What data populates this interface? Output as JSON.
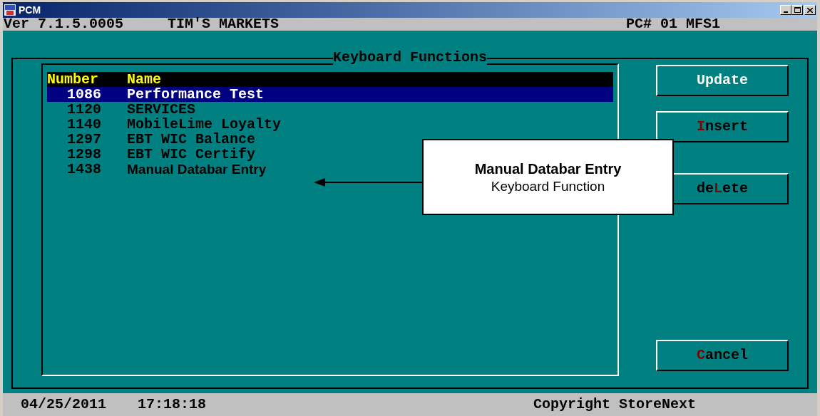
{
  "window": {
    "title": "PCM"
  },
  "header": {
    "version": "Ver 7.1.5.0005",
    "store": "TIM'S MARKETS",
    "terminal": "PC# 01 MFS1"
  },
  "panel": {
    "title": "Keyboard Functions"
  },
  "table": {
    "columns": [
      "Number",
      "Name"
    ],
    "rows": [
      {
        "number": "1086",
        "name": "Performance Test",
        "selected": true,
        "kind": "screen"
      },
      {
        "number": "1120",
        "name": "SERVICES",
        "selected": false,
        "kind": "screen"
      },
      {
        "number": "1140",
        "name": "MobileLime Loyalty",
        "selected": false,
        "kind": "screen"
      },
      {
        "number": "1297",
        "name": "EBT WIC Balance",
        "selected": false,
        "kind": "screen"
      },
      {
        "number": "1298",
        "name": "EBT WIC Certify",
        "selected": false,
        "kind": "screen"
      },
      {
        "number": "1438",
        "name": "Manual Databar Entry",
        "selected": false,
        "kind": "overlay"
      }
    ]
  },
  "buttons": [
    {
      "parts": [
        {
          "text": "Update",
          "hotkey": false
        }
      ],
      "focused": true
    },
    {
      "parts": [
        {
          "text": "I",
          "hotkey": true
        },
        {
          "text": "nsert",
          "hotkey": false
        }
      ],
      "focused": false
    },
    {
      "parts": [
        {
          "text": "de",
          "hotkey": false
        },
        {
          "text": "L",
          "hotkey": true
        },
        {
          "text": "ete",
          "hotkey": false
        }
      ],
      "focused": false
    },
    {
      "parts": [
        {
          "text": "C",
          "hotkey": true
        },
        {
          "text": "ancel",
          "hotkey": false
        }
      ],
      "focused": false
    }
  ],
  "callout": {
    "title": "Manual Databar Entry",
    "subtitle": "Keyboard Function"
  },
  "status_bar": {
    "date": "04/25/2011",
    "time": "17:18:18",
    "copyright": "Copyright StoreNext"
  }
}
